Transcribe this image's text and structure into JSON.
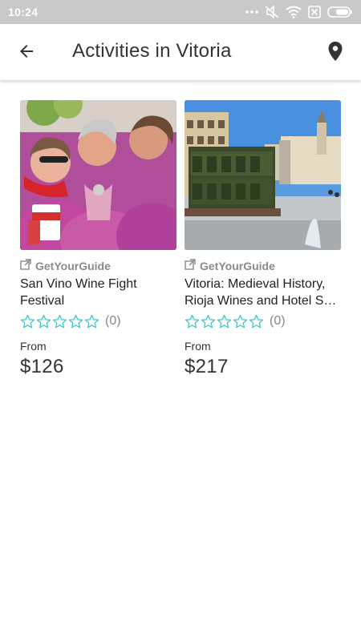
{
  "status_bar": {
    "time": "10:24",
    "icons": [
      "dots-icon",
      "mute-icon",
      "wifi-icon",
      "sim-off-icon",
      "battery-icon"
    ]
  },
  "header": {
    "title": "Activities in Vitoria",
    "back_icon": "arrow-left-icon",
    "map_icon": "location-pin-icon"
  },
  "colors": {
    "status_bar_bg": "#c9c9c9",
    "star_outline": "#3cc6c7",
    "text_muted": "#8a8a8a"
  },
  "activities": [
    {
      "provider": "GetYourGuide",
      "title": "San Vino Wine Fight Festival",
      "rating_stars_filled": 0,
      "rating_count": "(0)",
      "from_label": "From",
      "price": "$126"
    },
    {
      "provider": "GetYourGuide",
      "title": "Vitoria: Medieval History, Rioja Wines and Hotel S…",
      "rating_stars_filled": 0,
      "rating_count": "(0)",
      "from_label": "From",
      "price": "$217"
    }
  ]
}
